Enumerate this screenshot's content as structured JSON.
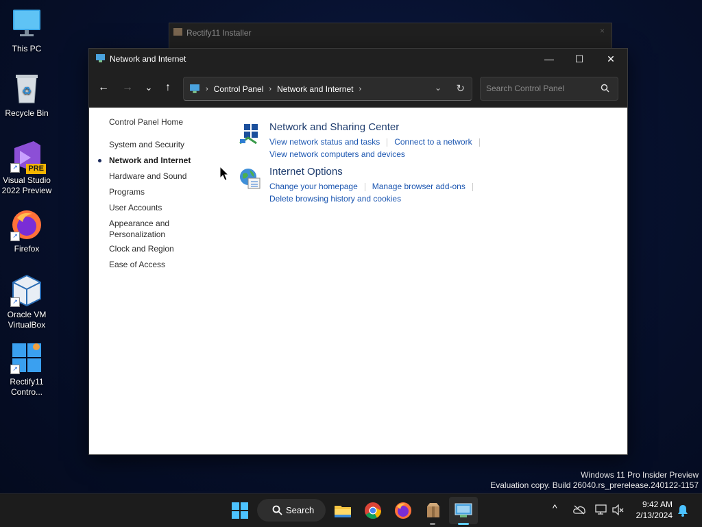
{
  "desktop": {
    "icons": [
      {
        "label_l1": "This PC",
        "label_l2": ""
      },
      {
        "label_l1": "Recycle Bin",
        "label_l2": ""
      },
      {
        "label_l1": "Visual Studio",
        "label_l2": "2022 Preview",
        "badge": "PRE"
      },
      {
        "label_l1": "Firefox",
        "label_l2": ""
      },
      {
        "label_l1": "Oracle VM",
        "label_l2": "VirtualBox"
      },
      {
        "label_l1": "Rectify11",
        "label_l2": "Contro..."
      }
    ]
  },
  "background_window": {
    "title": "Rectify11 Installer",
    "close": "×"
  },
  "window": {
    "title": "Network and Internet",
    "controls": {
      "minimize": "—",
      "maximize": "☐",
      "close": "✕"
    },
    "nav": {
      "back": "←",
      "forward": "→",
      "recent": "⌄",
      "up": "↑"
    },
    "address": {
      "crumbs": [
        "Control Panel",
        "Network and Internet"
      ],
      "sep": "›",
      "dropdown": "⌄",
      "refresh": "↻"
    },
    "search": {
      "placeholder": "Search Control Panel",
      "value": ""
    },
    "sidebar": {
      "home": "Control Panel Home",
      "items": [
        "System and Security",
        "Network and Internet",
        "Hardware and Sound",
        "Programs",
        "User Accounts",
        "Appearance and",
        "Personalization",
        "Clock and Region",
        "Ease of Access"
      ],
      "active_index": 1
    },
    "categories": [
      {
        "title": "Network and Sharing Center",
        "links": [
          "View network status and tasks",
          "Connect to a network",
          "View network computers and devices"
        ]
      },
      {
        "title": "Internet Options",
        "links": [
          "Change your homepage",
          "Manage browser add-ons",
          "Delete browsing history and cookies"
        ]
      }
    ]
  },
  "watermark": {
    "line1": "Windows 11 Pro Insider Preview",
    "line2": "Evaluation copy. Build 26040.rs_prerelease.240122-1157"
  },
  "taskbar": {
    "search_label": "Search",
    "time": "9:42 AM",
    "date": "2/13/2024",
    "tray_chevron": "^"
  },
  "colors": {
    "link": "#1a55b0",
    "heading": "#1f3d6e",
    "titlebar": "#202020",
    "taskbar": "#1c1c1c"
  }
}
